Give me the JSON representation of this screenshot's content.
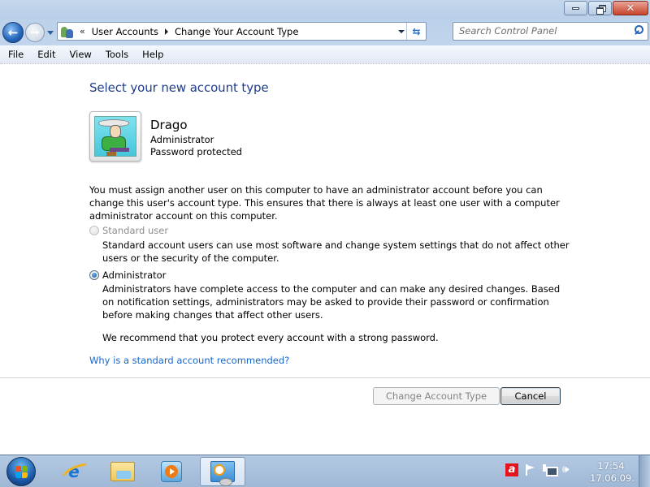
{
  "window": {
    "controls": {
      "minimize": "minimize",
      "restore": "restore",
      "close": "close"
    }
  },
  "nav": {
    "back_icon": "back-arrow-icon",
    "forward_icon": "forward-arrow-icon",
    "chevron": "«",
    "breadcrumbs": [
      {
        "label": "User Accounts"
      },
      {
        "label": "Change Your Account Type"
      }
    ],
    "refresh_glyph": "⇆",
    "search": {
      "placeholder": "Search Control Panel",
      "value": ""
    }
  },
  "menubar": {
    "items": [
      {
        "label": "File"
      },
      {
        "label": "Edit"
      },
      {
        "label": "View"
      },
      {
        "label": "Tools"
      },
      {
        "label": "Help"
      }
    ]
  },
  "content": {
    "title": "Select your new account type",
    "user": {
      "name": "Drago",
      "type": "Administrator",
      "password_status": "Password protected"
    },
    "warning": "You must assign another user on this computer to have an administrator account before you can change this user's account type. This ensures that there is always at least one user with a computer administrator account on this computer.",
    "options": [
      {
        "label": "Standard user",
        "selected": false,
        "disabled": true,
        "description": "Standard account users can use most software and change system settings that do not affect other users or the security of the computer."
      },
      {
        "label": "Administrator",
        "selected": true,
        "disabled": false,
        "description": "Administrators have complete access to the computer and can make any desired changes. Based on notification settings, administrators may be asked to provide their password or confirmation before making changes that affect other users.",
        "note": "We recommend that you protect every account with a strong password."
      }
    ],
    "help_link": "Why is a standard account recommended?",
    "buttons": {
      "change": {
        "label": "Change Account Type",
        "disabled": true
      },
      "cancel": {
        "label": "Cancel",
        "disabled": false
      }
    }
  },
  "taskbar": {
    "apps": [
      {
        "name": "Internet Explorer",
        "active": false
      },
      {
        "name": "Windows Explorer",
        "active": false
      },
      {
        "name": "Windows Media Player",
        "active": false
      },
      {
        "name": "Control Panel",
        "active": true
      }
    ],
    "tray": {
      "avira_glyph": "a",
      "volume_glyph": "🔊"
    },
    "clock": {
      "time": "17:54",
      "date": "17.06.09."
    }
  },
  "colors": {
    "title_blue": "#1f3d8c",
    "link_blue": "#1665cb",
    "disabled_text": "#8d8d8d"
  }
}
